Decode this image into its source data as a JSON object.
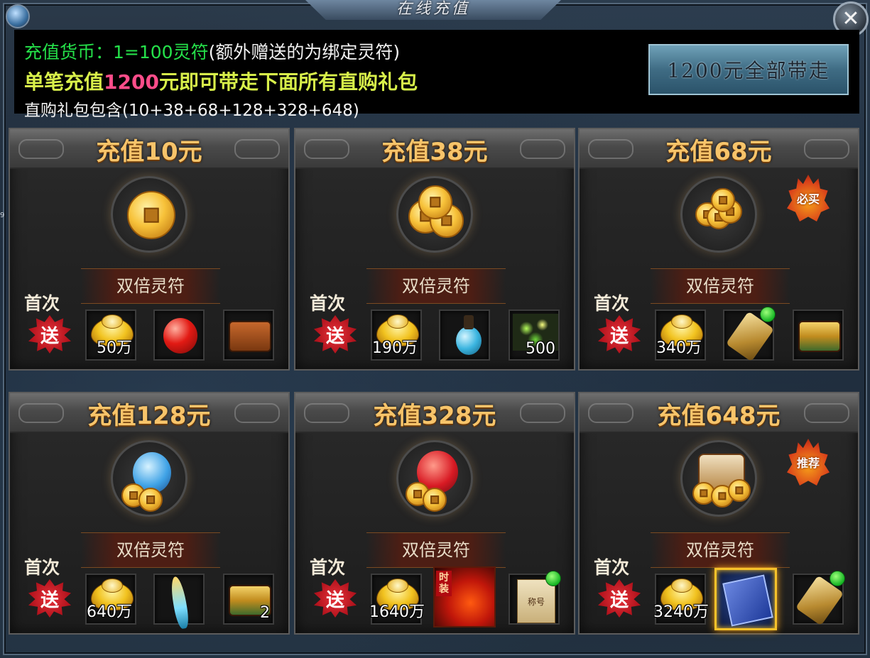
{
  "window": {
    "title": "在线充值",
    "close_label": "✕"
  },
  "info": {
    "rate_label": "充值货币：1=100灵符",
    "rate_note": "(额外赠送的为绑定灵符)",
    "promo_prefix": "单笔充值",
    "promo_amount": "1200",
    "promo_suffix": "元即可带走下面所有直购礼包",
    "contents": "直购礼包包含(10+38+68+128+328+648)",
    "buy_all_button": "1200元全部带走"
  },
  "common": {
    "double_label": "双倍灵符",
    "first_label": "首次",
    "gift_label": "送"
  },
  "side_number": "9",
  "cards": [
    {
      "title": "充值10元",
      "items": [
        {
          "icon": "gold-ingot-icon",
          "count": "50万"
        },
        {
          "icon": "red-apple-icon",
          "count": ""
        },
        {
          "icon": "bronze-chest-icon",
          "count": ""
        }
      ]
    },
    {
      "title": "充值38元",
      "items": [
        {
          "icon": "gold-ingot-icon",
          "count": "190万"
        },
        {
          "icon": "blue-potion-icon",
          "count": ""
        },
        {
          "icon": "green-sparkle-icon",
          "count": "500"
        }
      ]
    },
    {
      "title": "充值68元",
      "badge": "必买",
      "items": [
        {
          "icon": "gold-ingot-icon",
          "count": "340万"
        },
        {
          "icon": "golden-scroll-icon",
          "count": ""
        },
        {
          "icon": "golden-chest-icon",
          "count": ""
        }
      ]
    },
    {
      "title": "充值128元",
      "items": [
        {
          "icon": "gold-ingot-icon",
          "count": "640万"
        },
        {
          "icon": "blade-icon",
          "count": ""
        },
        {
          "icon": "golden-chest-icon",
          "count": "2"
        }
      ]
    },
    {
      "title": "充值328元",
      "items": [
        {
          "icon": "gold-ingot-icon",
          "count": "1640万"
        },
        {
          "icon": "fire-fashion-icon",
          "count": "",
          "tag": "时装"
        },
        {
          "icon": "title-scroll-icon",
          "count": "",
          "label": "称号"
        }
      ]
    },
    {
      "title": "充值648元",
      "badge": "推荐",
      "items": [
        {
          "icon": "gold-ingot-icon",
          "count": "3240万"
        },
        {
          "icon": "magic-book-icon",
          "count": ""
        },
        {
          "icon": "golden-scroll-icon",
          "count": ""
        }
      ]
    }
  ]
}
